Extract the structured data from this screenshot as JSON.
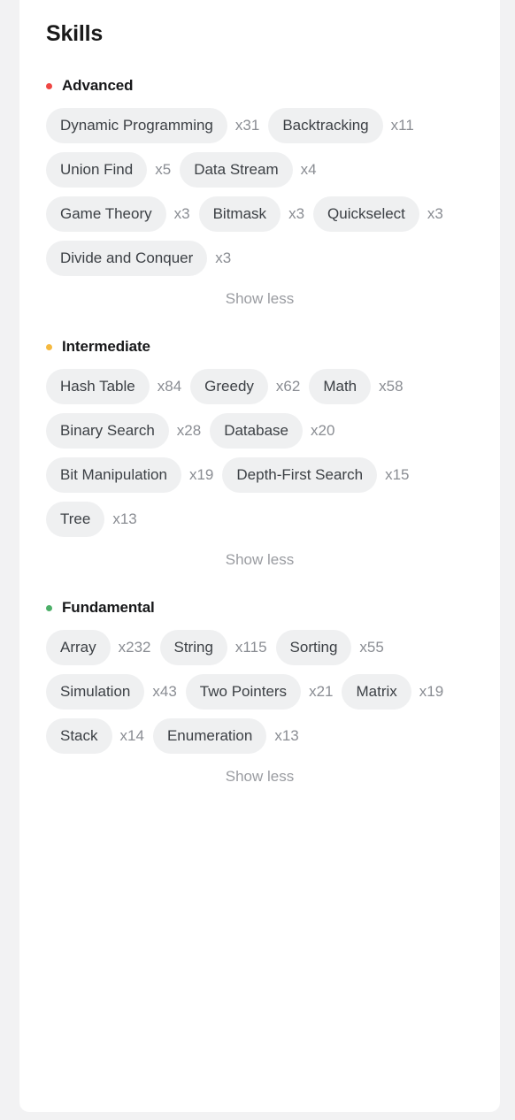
{
  "card": {
    "title": "Skills"
  },
  "colors": {
    "page_background": "#f2f2f3",
    "card_background": "#ffffff",
    "pill_background": "#eff0f1",
    "advanced_dot": "#ef4743",
    "intermediate_dot": "#f5b93f",
    "fundamental_dot": "#4caf68"
  },
  "sections": [
    {
      "name": "Advanced",
      "dot_color": "#ef4743",
      "dot_icon": "bullet-dot-icon",
      "show_less_label": "Show less",
      "tags": [
        {
          "label": "Dynamic Programming",
          "count": "x31"
        },
        {
          "label": "Backtracking",
          "count": "x11"
        },
        {
          "label": "Union Find",
          "count": "x5"
        },
        {
          "label": "Data Stream",
          "count": "x4"
        },
        {
          "label": "Game Theory",
          "count": "x3"
        },
        {
          "label": "Bitmask",
          "count": "x3"
        },
        {
          "label": "Quickselect",
          "count": "x3"
        },
        {
          "label": "Divide and Conquer",
          "count": "x3"
        }
      ]
    },
    {
      "name": "Intermediate",
      "dot_color": "#f5b93f",
      "dot_icon": "bullet-dot-icon",
      "show_less_label": "Show less",
      "tags": [
        {
          "label": "Hash Table",
          "count": "x84"
        },
        {
          "label": "Greedy",
          "count": "x62"
        },
        {
          "label": "Math",
          "count": "x58"
        },
        {
          "label": "Binary Search",
          "count": "x28"
        },
        {
          "label": "Database",
          "count": "x20"
        },
        {
          "label": "Bit Manipulation",
          "count": "x19"
        },
        {
          "label": "Depth-First Search",
          "count": "x15"
        },
        {
          "label": "Tree",
          "count": "x13"
        }
      ]
    },
    {
      "name": "Fundamental",
      "dot_color": "#4caf68",
      "dot_icon": "bullet-dot-icon",
      "show_less_label": "Show less",
      "tags": [
        {
          "label": "Array",
          "count": "x232"
        },
        {
          "label": "String",
          "count": "x115"
        },
        {
          "label": "Sorting",
          "count": "x55"
        },
        {
          "label": "Simulation",
          "count": "x43"
        },
        {
          "label": "Two Pointers",
          "count": "x21"
        },
        {
          "label": "Matrix",
          "count": "x19"
        },
        {
          "label": "Stack",
          "count": "x14"
        },
        {
          "label": "Enumeration",
          "count": "x13"
        }
      ]
    }
  ]
}
